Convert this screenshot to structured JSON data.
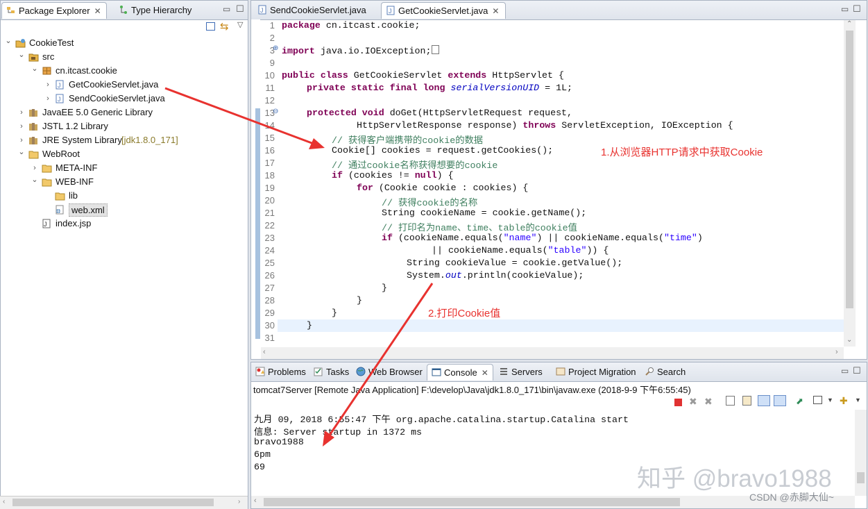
{
  "left_panel": {
    "tabs": [
      {
        "label": "Package Explorer"
      },
      {
        "label": "Type Hierarchy"
      }
    ],
    "tree": [
      {
        "label": "CookieTest",
        "decoration": ""
      },
      {
        "label": "src",
        "decoration": ""
      },
      {
        "label": "cn.itcast.cookie",
        "decoration": ""
      },
      {
        "label": "GetCookieServlet.java",
        "decoration": ""
      },
      {
        "label": "SendCookieServlet.java",
        "decoration": ""
      },
      {
        "label": "JavaEE 5.0 Generic Library",
        "decoration": ""
      },
      {
        "label": "JSTL 1.2 Library",
        "decoration": ""
      },
      {
        "label": "JRE System Library",
        "decoration": "[jdk1.8.0_171]"
      },
      {
        "label": "WebRoot",
        "decoration": ""
      },
      {
        "label": "META-INF",
        "decoration": ""
      },
      {
        "label": "WEB-INF",
        "decoration": ""
      },
      {
        "label": "lib",
        "decoration": ""
      },
      {
        "label": "web.xml",
        "decoration": ""
      },
      {
        "label": "index.jsp",
        "decoration": ""
      }
    ]
  },
  "editor": {
    "tabs": [
      {
        "label": "SendCookieServlet.java"
      },
      {
        "label": "GetCookieServlet.java"
      }
    ],
    "line_numbers": [
      "1",
      "2",
      "3",
      "9",
      "10",
      "11",
      "12",
      "13",
      "14",
      "15",
      "16",
      "17",
      "18",
      "19",
      "20",
      "21",
      "22",
      "23",
      "24",
      "25",
      "26",
      "27",
      "28",
      "29",
      "30",
      "31"
    ],
    "lines": {
      "l1": "package cn.itcast.cookie;",
      "l3_kw": "import",
      "l3": " java.io.IOException;",
      "l10_a": "public class",
      "l10_b": " GetCookieServlet ",
      "l10_c": "extends",
      "l10_d": " HttpServlet {",
      "l11_a": "private static final long",
      "l11_b": "serialVersionUID",
      "l11_c": " = 1L;",
      "l13_a": "protected void",
      "l13_b": " doGet(HttpServletRequest request,",
      "l14_a": "HttpServletResponse response) ",
      "l14_b": "throws",
      "l14_c": " ServletException, IOException {",
      "l15": "// 获得客户端携带的cookie的数据",
      "l16": "Cookie[] cookies = request.getCookies();",
      "l17": "// 通过cookie名称获得想要的cookie",
      "l18_a": "if",
      "l18_b": " (cookies != ",
      "l18_c": "null",
      "l18_d": ") {",
      "l19_a": "for",
      "l19_b": " (Cookie cookie : cookies) {",
      "l20": "// 获得cookie的名称",
      "l21": "String cookieName = cookie.getName();",
      "l22": "// 打印名为name、time、table的cookie值",
      "l23_a": "if",
      "l23_b": " (cookieName.equals(",
      "l23_c": "\"name\"",
      "l23_d": ") || cookieName.equals(",
      "l23_e": "\"time\"",
      "l23_f": ")",
      "l24_a": "|| cookieName.equals(",
      "l24_b": "\"table\"",
      "l24_c": ")) {",
      "l25": "String cookieValue = cookie.getValue();",
      "l26_a": "System.",
      "l26_b": "out",
      "l26_c": ".println(cookieValue);",
      "l27": "}",
      "l28": "}",
      "l29": "}",
      "l30": "}"
    },
    "annotation_1": "1.从浏览器HTTP请求中获取Cookie",
    "annotation_2": "2.打印Cookie值"
  },
  "bottom_panel": {
    "tabs": [
      {
        "label": "Problems"
      },
      {
        "label": "Tasks"
      },
      {
        "label": "Web Browser"
      },
      {
        "label": "Console"
      },
      {
        "label": "Servers"
      },
      {
        "label": "Project Migration"
      },
      {
        "label": "Search"
      }
    ],
    "console_title": "tomcat7Server [Remote Java Application] F:\\develop\\Java\\jdk1.8.0_171\\bin\\javaw.exe (2018-9-9 下午6:55:45)",
    "console_lines": [
      "九月 09, 2018 6:55:47 下午 org.apache.catalina.startup.Catalina start",
      "信息: Server startup in 1372 ms",
      "bravo1988",
      "6pm",
      "69"
    ]
  },
  "watermarks": {
    "zhihu": "知乎 @bravo1988",
    "csdn": "CSDN @赤脚大仙~"
  },
  "colors": {
    "keyword": "#7f0055",
    "comment": "#3f7f5f",
    "string": "#2a00ff",
    "annotation": "#e8322f",
    "current_line": "#e8f2fe"
  }
}
